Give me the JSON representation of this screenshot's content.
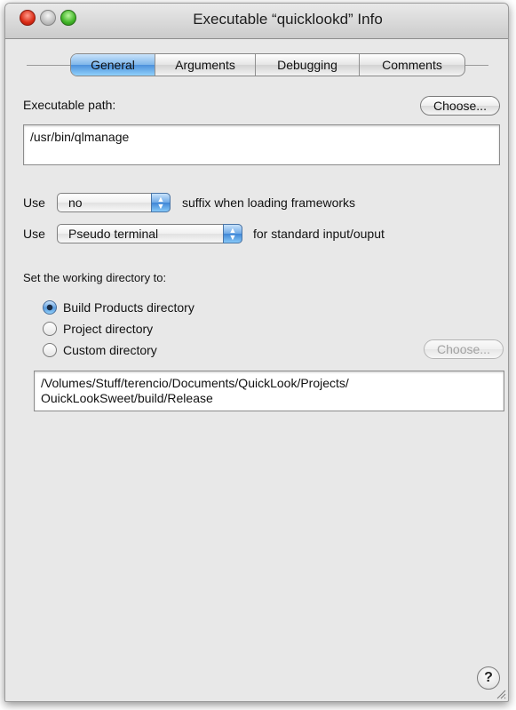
{
  "window": {
    "title": "Executable “quicklookd” Info"
  },
  "tabs": [
    {
      "label": "General",
      "active": true
    },
    {
      "label": "Arguments",
      "active": false
    },
    {
      "label": "Debugging",
      "active": false
    },
    {
      "label": "Comments",
      "active": false
    }
  ],
  "executable": {
    "label": "Executable path:",
    "choose_label": "Choose...",
    "path": "/usr/bin/qlmanage"
  },
  "suffix_row": {
    "use_label": "Use",
    "selected": "no",
    "trailing_label": "suffix when loading frameworks"
  },
  "terminal_row": {
    "use_label": "Use",
    "selected": "Pseudo terminal",
    "trailing_label": "for standard input/ouput"
  },
  "working_dir": {
    "label": "Set the working directory to:",
    "options": [
      {
        "label": "Build Products directory",
        "selected": true
      },
      {
        "label": "Project directory",
        "selected": false
      },
      {
        "label": "Custom directory",
        "selected": false
      }
    ],
    "choose_label": "Choose...",
    "path_line1": "/Volumes/Stuff/terencio/Documents/QuickLook/Projects/",
    "path_line2": "OuickLookSweet/build/Release"
  },
  "help": {
    "glyph": "?"
  },
  "colors": {
    "accent": "#5b9de0",
    "background": "#e8e8e8"
  },
  "icons": [
    "close-button-icon",
    "minimize-button-icon",
    "zoom-button-icon",
    "popup-arrows-icon",
    "radio-icon",
    "help-icon",
    "resize-grip-icon"
  ]
}
